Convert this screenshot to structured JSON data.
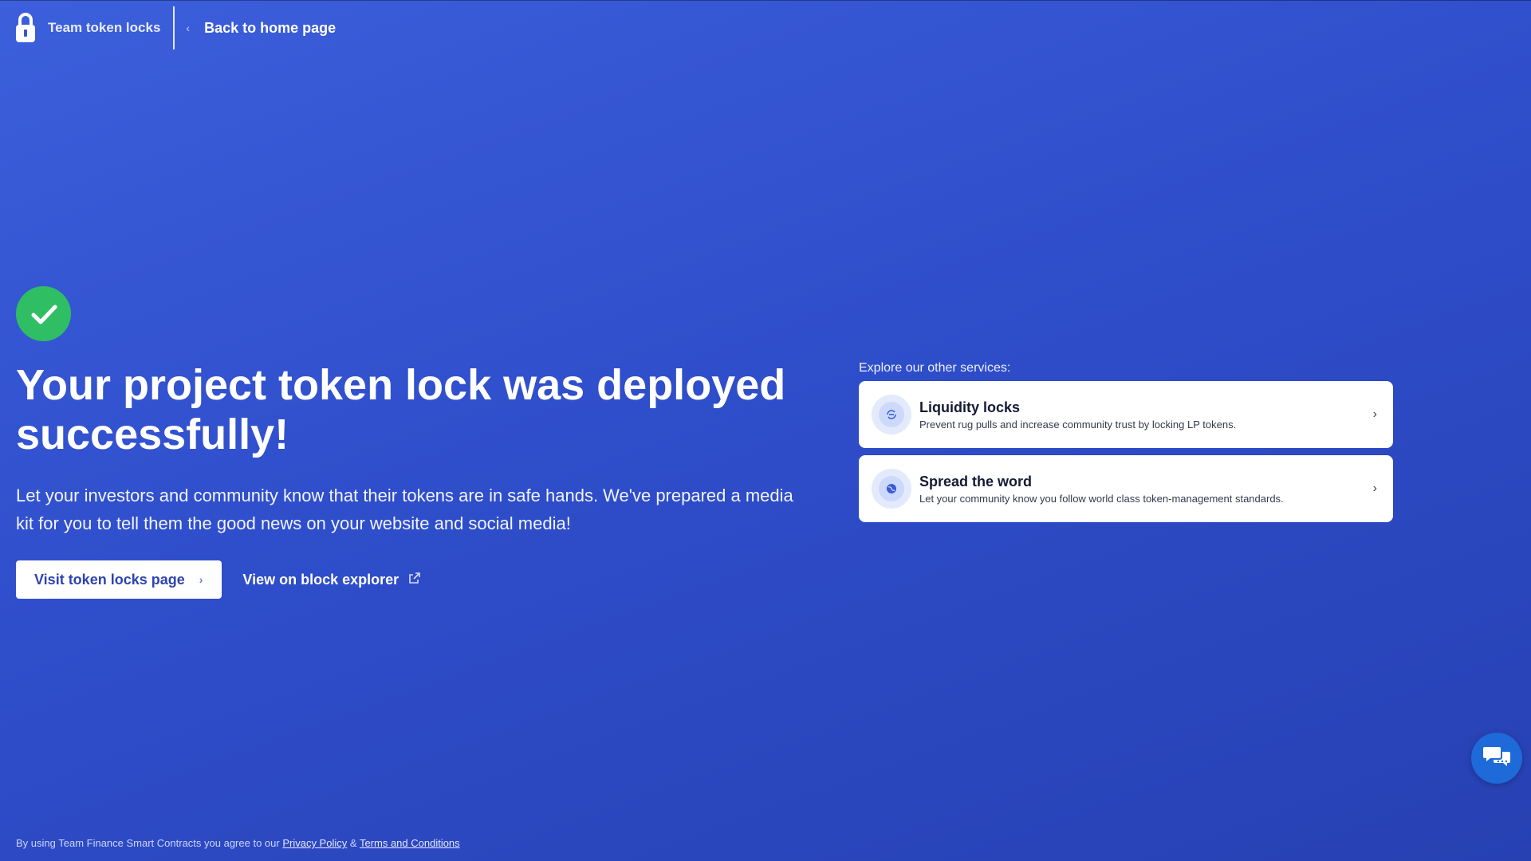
{
  "header": {
    "brand_name": "Team token locks",
    "back_label": "Back to home page"
  },
  "main": {
    "headline_line1": "Your project token lock was deployed",
    "headline_line2": "successfully!",
    "description_line1": "Let your investors and community know that their tokens are in safe hands. We've prepared a media",
    "description_line2": "kit for you to tell them the good news on your website and social media!",
    "primary_button": "Visit token locks page",
    "secondary_link": "View on block explorer"
  },
  "services": {
    "label": "Explore our other services:",
    "items": [
      {
        "title": "Liquidity locks",
        "description": "Prevent rug pulls and increase community trust by locking LP tokens.",
        "icon": "lock-link-icon"
      },
      {
        "title": "Spread the word",
        "description": "Let your community know you follow world class token-management standards.",
        "icon": "globe-icon"
      }
    ]
  },
  "footer": {
    "prefix": "By using Team Finance Smart Contracts you agree to our",
    "privacy_link": "Privacy Policy",
    "ampersand": "&",
    "terms_link": "Terms and Conditions"
  },
  "colors": {
    "background": "#2f4ecb",
    "success": "#2fbe63",
    "primary_text": "#2c43b3",
    "chat": "#1e6ad8"
  }
}
